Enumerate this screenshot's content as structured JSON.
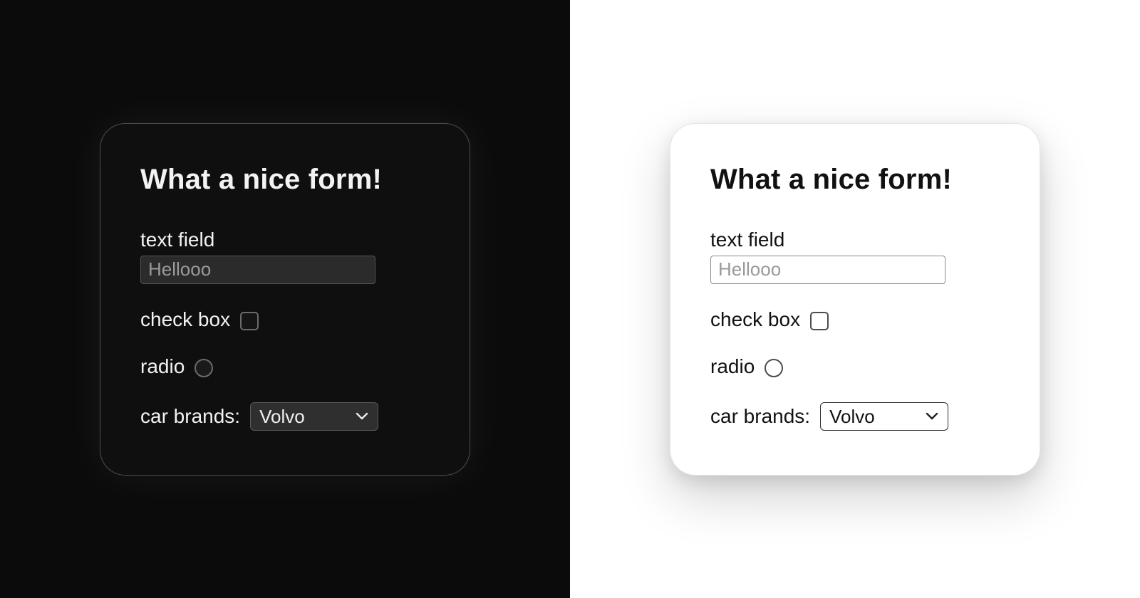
{
  "themes": {
    "dark": "dark",
    "light": "light"
  },
  "form": {
    "title": "What a nice form!",
    "text": {
      "label": "text field",
      "placeholder": "Hellooo",
      "value": ""
    },
    "checkbox": {
      "label": "check box",
      "checked": false
    },
    "radio": {
      "label": "radio",
      "selected": false
    },
    "select": {
      "label": "car brands:",
      "value": "Volvo",
      "options": [
        "Volvo"
      ]
    }
  }
}
